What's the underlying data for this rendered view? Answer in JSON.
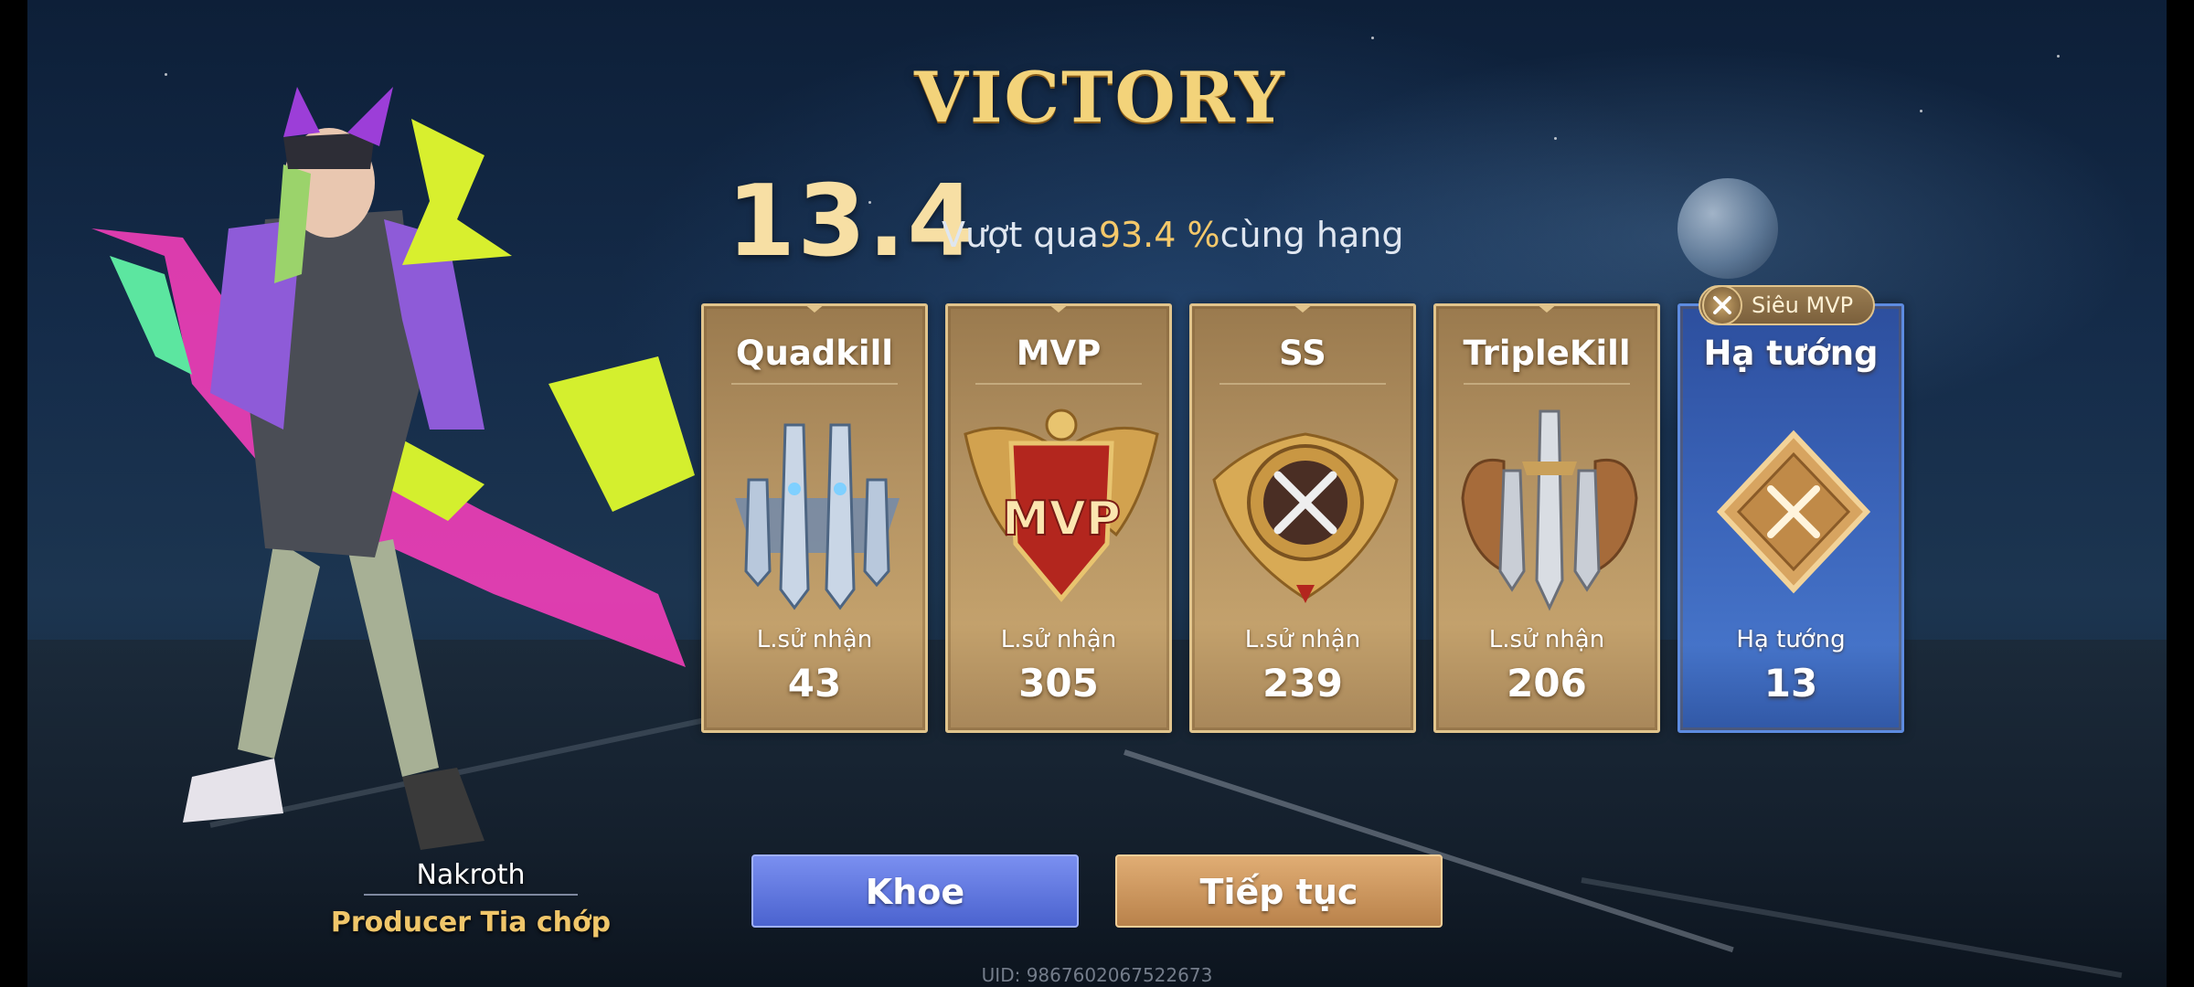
{
  "result": {
    "title": "VICTORY",
    "score": "13.4",
    "surpass_prefix": "Vượt qua",
    "surpass_pct": "93.4 %",
    "surpass_suffix": "cùng hạng"
  },
  "cards": [
    {
      "title": "Quadkill",
      "label": "L.sử nhận",
      "value": "43",
      "emblem": "quadkill-swords-emblem"
    },
    {
      "title": "MVP",
      "label": "L.sử nhận",
      "value": "305",
      "emblem": "mvp-shield-emblem",
      "emblem_text": "MVP"
    },
    {
      "title": "SS",
      "label": "L.sử nhận",
      "value": "239",
      "emblem": "ss-crossed-swords-emblem"
    },
    {
      "title": "TripleKill",
      "label": "L.sử nhận",
      "value": "206",
      "emblem": "triplekill-swords-emblem"
    },
    {
      "title": "Hạ tướng",
      "label": "Hạ tướng",
      "value": "13",
      "emblem": "kill-diamond-emblem"
    }
  ],
  "badge": {
    "label": "Siêu MVP",
    "icon": "crossed-swords-icon"
  },
  "hero": {
    "name": "Nakroth",
    "skin": "Producer Tia chớp"
  },
  "buttons": {
    "khoe": "Khoe",
    "tiep_tuc": "Tiếp tục"
  },
  "uid": "UID: 9867602067522673",
  "colors": {
    "gold": "#f3d37a",
    "card_gold": "#b39262",
    "card_blue": "#3a63b8",
    "button_blue": "#5a71da",
    "button_orange": "#cd9760"
  }
}
